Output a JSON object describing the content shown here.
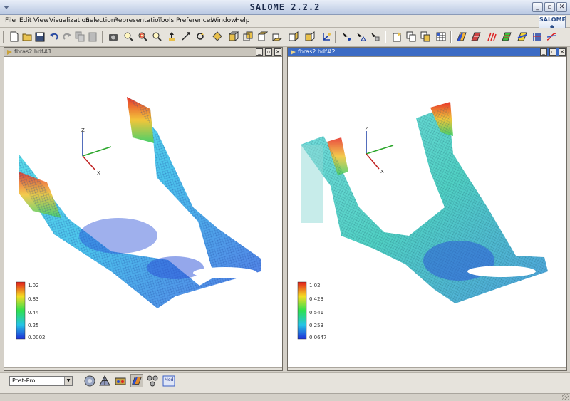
{
  "window": {
    "title": "SALOME 2.2.2",
    "logo": "SALOME"
  },
  "menubar": [
    {
      "label": "File"
    },
    {
      "label": "Edit"
    },
    {
      "label": "View"
    },
    {
      "label": "Visualization"
    },
    {
      "label": "Selection"
    },
    {
      "label": "Representation"
    },
    {
      "label": "Tools"
    },
    {
      "label": "Preferences"
    },
    {
      "label": "Window"
    },
    {
      "label": "Help"
    }
  ],
  "views": [
    {
      "title": "fbras2.hdf#1",
      "scalar_bar": [
        "1.02",
        "0.83",
        "0.44",
        "0.25",
        "0.0002"
      ],
      "axes": {
        "z": "Z",
        "x": "X"
      }
    },
    {
      "title": "fbras2.hdf#2",
      "scalar_bar": [
        "1.02",
        "0.423",
        "0.541",
        "0.253",
        "0.0647"
      ],
      "axes": {
        "z": "Z",
        "x": "X"
      }
    }
  ],
  "bottom": {
    "module_selector": "Post-Pro"
  },
  "colors": {
    "active_caption": "#3c6bc4",
    "window_bg": "#d4d0c8"
  }
}
